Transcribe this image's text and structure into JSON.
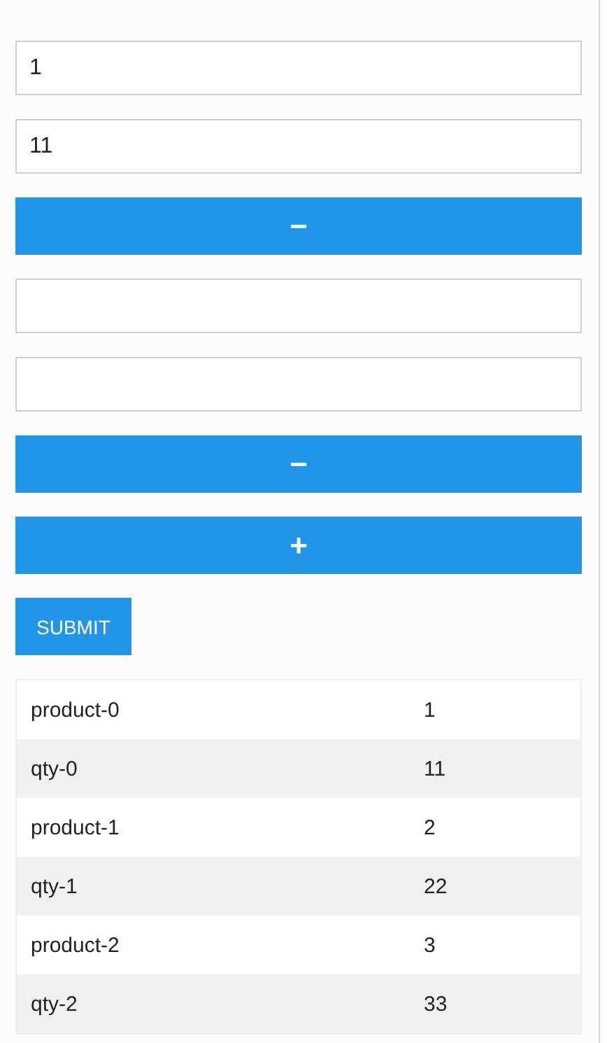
{
  "form": [
    {
      "kind": "field",
      "value": "1"
    },
    {
      "kind": "field",
      "value": "11"
    },
    {
      "kind": "remove",
      "label": "−"
    },
    {
      "kind": "field"
    },
    {
      "kind": "field"
    },
    {
      "kind": "remove",
      "label": "−"
    },
    {
      "kind": "add",
      "label": "+"
    }
  ],
  "submit": {
    "label": "SUBMIT"
  },
  "table": {
    "rows": [
      {
        "key": "product-0",
        "value": "1"
      },
      {
        "key": "qty-0",
        "value": "11"
      },
      {
        "key": "product-1",
        "value": "2"
      },
      {
        "key": "qty-1",
        "value": "22"
      },
      {
        "key": "product-2",
        "value": "3"
      },
      {
        "key": "qty-2",
        "value": "33"
      }
    ]
  }
}
